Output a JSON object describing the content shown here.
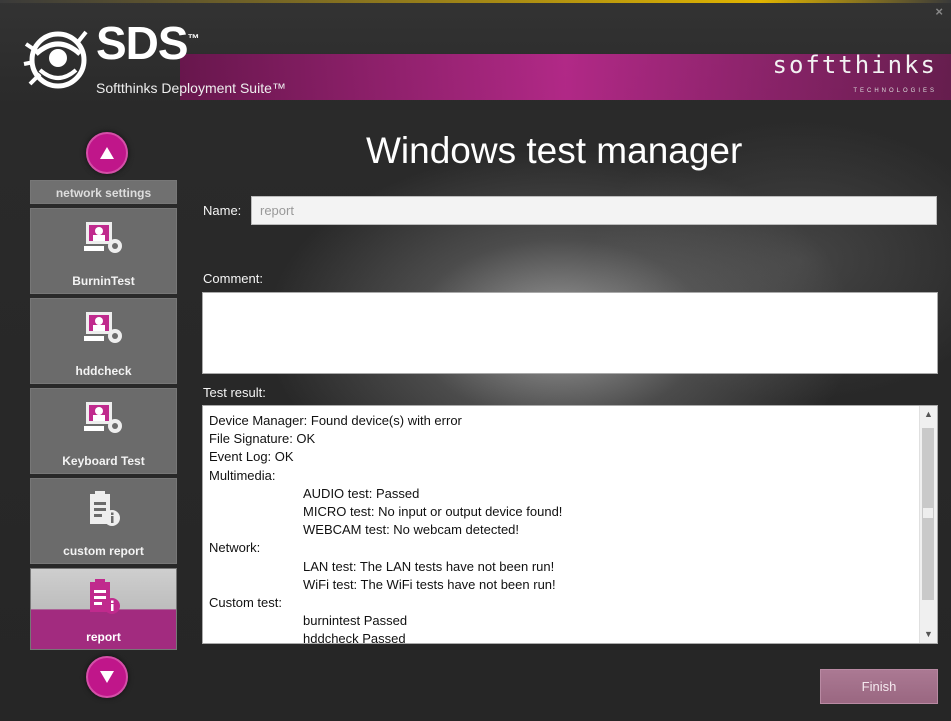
{
  "app": {
    "logo_text": "SDS",
    "logo_tm": "™",
    "subtitle": "Softthinks Deployment Suite™",
    "brand": "softthinks",
    "brand_sub": "TECHNOLOGIES",
    "close": "×"
  },
  "page": {
    "title": "Windows test manager"
  },
  "sidebar": {
    "header": "network settings",
    "items": [
      {
        "label": "BurninTest",
        "icon": "computer-gear-icon",
        "selected": false
      },
      {
        "label": "hddcheck",
        "icon": "computer-gear-icon",
        "selected": false
      },
      {
        "label": "Keyboard Test",
        "icon": "computer-gear-icon",
        "selected": false
      },
      {
        "label": "custom report",
        "icon": "clipboard-info-icon",
        "selected": false
      },
      {
        "label": "report",
        "icon": "clipboard-info-icon",
        "selected": true
      }
    ]
  },
  "form": {
    "name_label": "Name:",
    "name_value": "report",
    "comment_label": "Comment:",
    "comment_value": "",
    "result_label": "Test result:"
  },
  "result_lines": [
    {
      "text": "Device Manager: Found device(s) with error",
      "indent": false
    },
    {
      "text": "File Signature: OK",
      "indent": false
    },
    {
      "text": "Event Log: OK",
      "indent": false
    },
    {
      "text": "Multimedia:",
      "indent": false
    },
    {
      "text": "AUDIO test: Passed",
      "indent": true
    },
    {
      "text": "MICRO test: No input or output device found!",
      "indent": true
    },
    {
      "text": "WEBCAM test: No webcam detected!",
      "indent": true
    },
    {
      "text": "Network:",
      "indent": false
    },
    {
      "text": "LAN test: The LAN tests have not been run!",
      "indent": true
    },
    {
      "text": "WiFi test: The WiFi tests have not been run!",
      "indent": true
    },
    {
      "text": "Custom test:",
      "indent": false
    },
    {
      "text": "burnintest Passed",
      "indent": true
    },
    {
      "text": "hddcheck Passed",
      "indent": true
    }
  ],
  "buttons": {
    "finish": "Finish"
  },
  "colors": {
    "accent": "#c0168a",
    "selected": "#a22b7f",
    "finish": "#a36f8a"
  }
}
